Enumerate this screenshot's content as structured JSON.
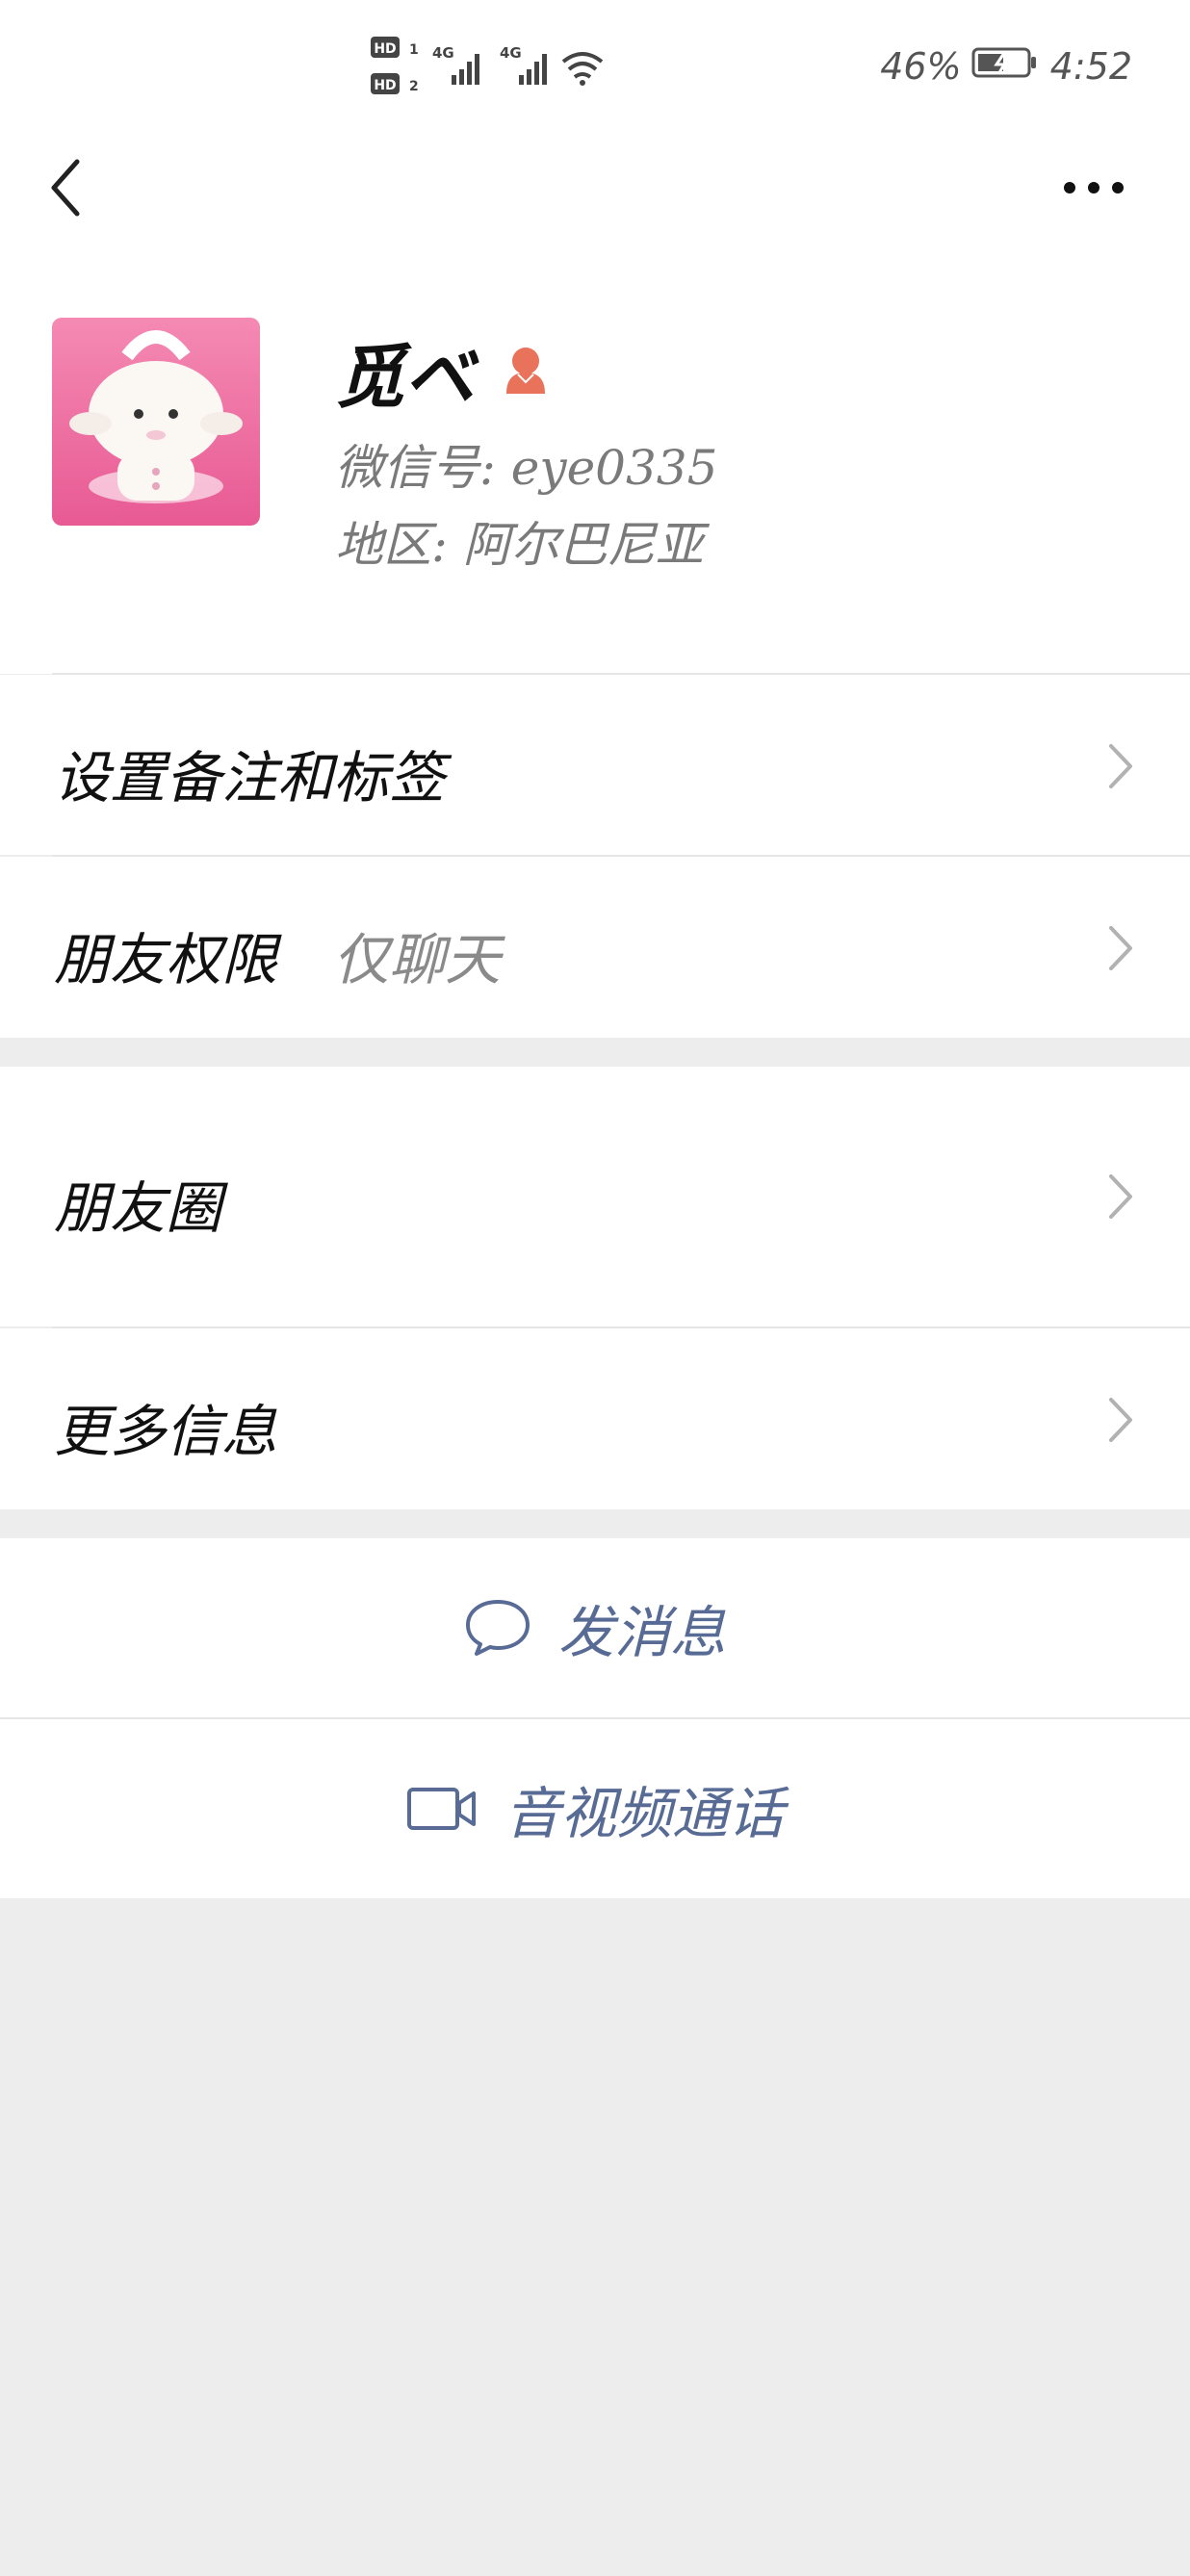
{
  "status_bar": {
    "sim1": "HD 1",
    "sim2": "HD 2",
    "net1": "4G",
    "net2": "4G",
    "battery": "46%",
    "time": "4:52"
  },
  "nav": {
    "back_icon": "chevron-left-icon",
    "more_icon": "more-dots-icon"
  },
  "profile": {
    "name": "觅ベ",
    "gender_icon": "female-user-icon",
    "wechat_id": "微信号: eye0335",
    "region": "地区: 阿尔巴尼亚"
  },
  "menu": {
    "remark_tags": "设置备注和标签",
    "friend_permission_label": "朋友权限",
    "friend_permission_value": "仅聊天",
    "moments": "朋友圈",
    "more_info": "更多信息"
  },
  "actions": {
    "send_message": "发消息",
    "video_call": "音视频通话"
  },
  "colors": {
    "link": "#576b95",
    "background": "#ededed",
    "gender_female": "#e8735a"
  }
}
